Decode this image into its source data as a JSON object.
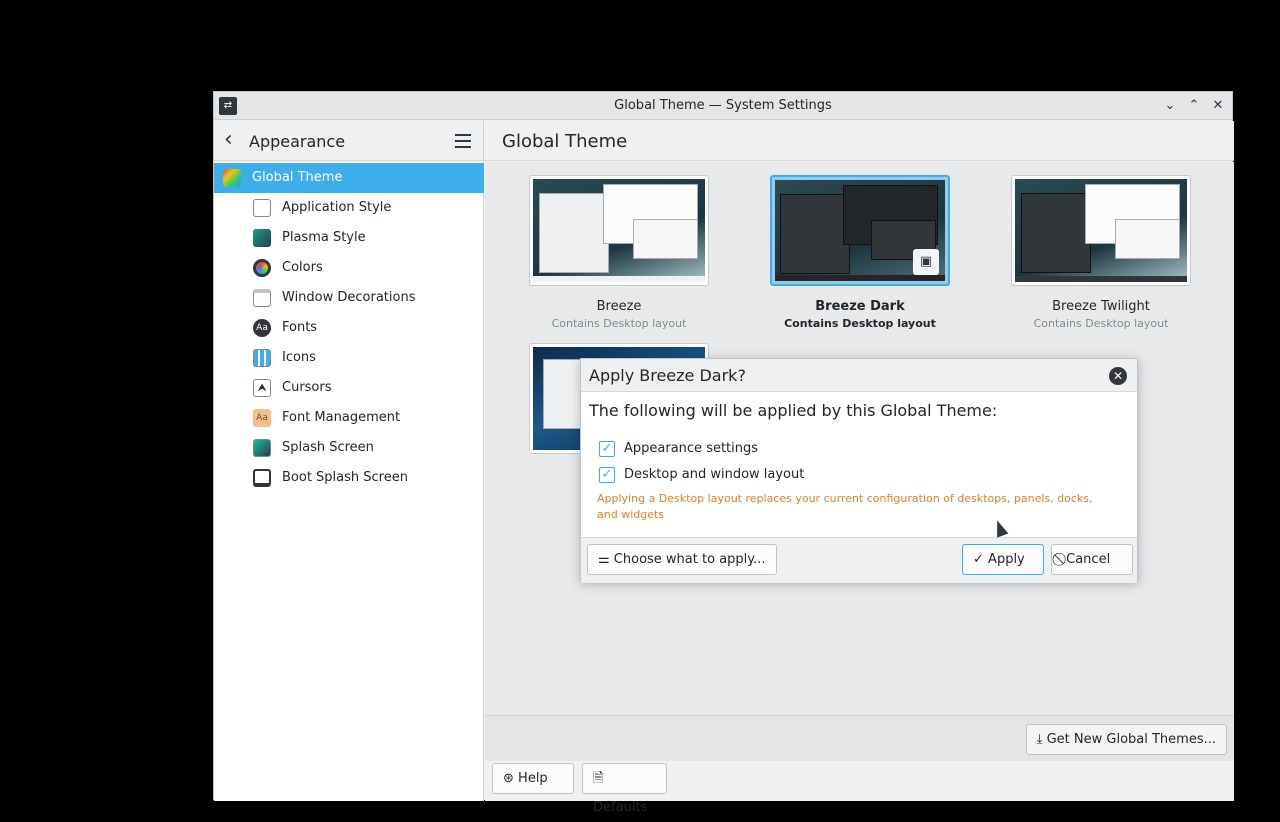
{
  "window": {
    "title": "Global Theme — System Settings"
  },
  "sidebar": {
    "title": "Appearance",
    "items": [
      {
        "label": "Global Theme",
        "icon": "global-theme-icon",
        "active": true
      },
      {
        "label": "Application Style",
        "icon": "application-style-icon"
      },
      {
        "label": "Plasma Style",
        "icon": "plasma-style-icon"
      },
      {
        "label": "Colors",
        "icon": "colors-icon"
      },
      {
        "label": "Window Decorations",
        "icon": "window-decorations-icon"
      },
      {
        "label": "Fonts",
        "icon": "fonts-icon"
      },
      {
        "label": "Icons",
        "icon": "icons-icon"
      },
      {
        "label": "Cursors",
        "icon": "cursors-icon"
      },
      {
        "label": "Font Management",
        "icon": "font-management-icon"
      },
      {
        "label": "Splash Screen",
        "icon": "splash-screen-icon"
      },
      {
        "label": "Boot Splash Screen",
        "icon": "boot-splash-icon"
      }
    ]
  },
  "content": {
    "title": "Global Theme",
    "themes": [
      {
        "name": "Breeze",
        "subtitle": "Contains Desktop layout",
        "selected": false
      },
      {
        "name": "Breeze Dark",
        "subtitle": "Contains Desktop layout",
        "selected": true
      },
      {
        "name": "Breeze Twilight",
        "subtitle": "Contains Desktop layout",
        "selected": false
      }
    ],
    "get_new_label": "Get New Global Themes..."
  },
  "footer": {
    "help_label": "Help",
    "defaults_label": "Defaults"
  },
  "dialog": {
    "title": "Apply Breeze Dark?",
    "heading": "The following will be applied by this Global Theme:",
    "options": [
      {
        "label": "Appearance settings",
        "checked": true
      },
      {
        "label": "Desktop and window layout",
        "checked": true
      }
    ],
    "warning": "Applying a Desktop layout replaces your current configuration of desktops, panels, docks, and widgets",
    "choose_label": "Choose what to apply...",
    "apply_label": "Apply",
    "cancel_label": "Cancel"
  },
  "colors": {
    "accent": "#3daee9",
    "warning": "#e67e22"
  }
}
